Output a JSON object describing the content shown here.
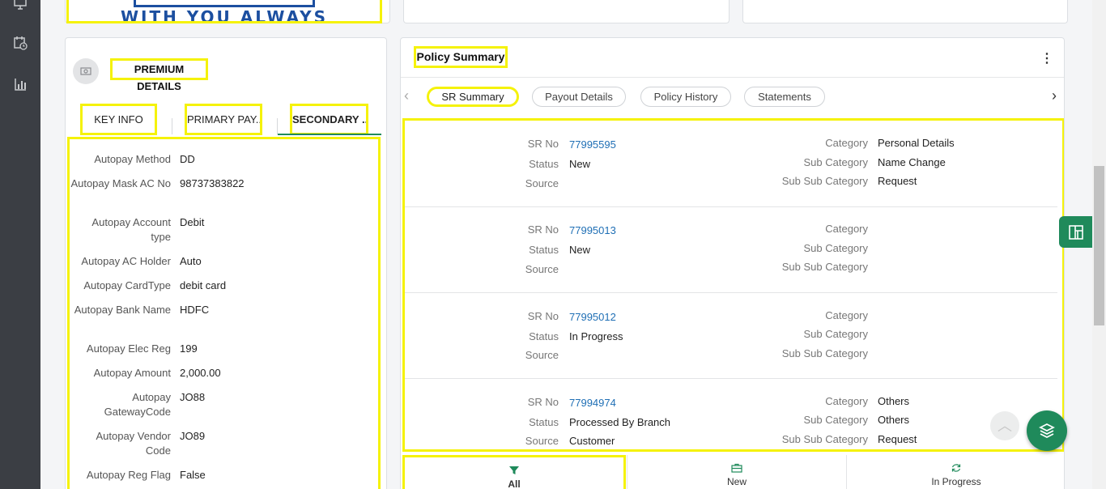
{
  "banner": {
    "text": "WITH YOU ALWAYS"
  },
  "premium": {
    "title": "PREMIUM DETAILS",
    "tabs": [
      {
        "label": "KEY INFO"
      },
      {
        "label": "PRIMARY PAY..."
      },
      {
        "label": "SECONDARY ..."
      }
    ],
    "active_tab": "SECONDARY ...",
    "fields": [
      {
        "label": "Autopay Method",
        "value": "DD"
      },
      {
        "label": "Autopay Mask AC No",
        "value": "98737383822"
      },
      {
        "label": "Autopay Account type",
        "value": "Debit"
      },
      {
        "label": "Autopay AC Holder",
        "value": "Auto"
      },
      {
        "label": "Autopay CardType",
        "value": "debit card"
      },
      {
        "label": "Autopay Bank Name",
        "value": "HDFC"
      },
      {
        "label": "Autopay Elec Reg",
        "value": "199"
      },
      {
        "label": "Autopay Amount",
        "value": "2,000.00"
      },
      {
        "label": "Autopay GatewayCode",
        "value": "JO88"
      },
      {
        "label": "Autopay Vendor Code",
        "value": "JO89"
      },
      {
        "label": "Autopay Reg Flag",
        "value": "False"
      }
    ]
  },
  "policy": {
    "title": "Policy Summary",
    "menu_icon": "kebab-icon",
    "tabs": [
      {
        "label": "SR Summary"
      },
      {
        "label": "Payout Details"
      },
      {
        "label": "Policy History"
      },
      {
        "label": "Statements"
      }
    ],
    "active_tab": "SR Summary",
    "labels": {
      "sr_no": "SR No",
      "status": "Status",
      "source": "Source",
      "category": "Category",
      "sub_category": "Sub Category",
      "sub_sub_category": "Sub Sub Category"
    },
    "records": [
      {
        "sr_no": "77995595",
        "status": "New",
        "source": "",
        "category": "Personal Details",
        "sub_category": "Name Change",
        "sub_sub_category": "Request"
      },
      {
        "sr_no": "77995013",
        "status": "New",
        "source": "",
        "category": "",
        "sub_category": "",
        "sub_sub_category": ""
      },
      {
        "sr_no": "77995012",
        "status": "In Progress",
        "source": "",
        "category": "",
        "sub_category": "",
        "sub_sub_category": ""
      },
      {
        "sr_no": "77994974",
        "status": "Processed By Branch",
        "source": "Customer",
        "category": "Others",
        "sub_category": "Others",
        "sub_sub_category": "Request"
      }
    ],
    "bottom_tabs": [
      {
        "label": "All",
        "icon": "filter-icon"
      },
      {
        "label": "New",
        "icon": "briefcase-icon"
      },
      {
        "label": "In Progress",
        "icon": "refresh-icon"
      }
    ],
    "active_bottom_tab": "All"
  },
  "colors": {
    "accent": "#1f8a5b",
    "link": "#1f6fb5",
    "highlight": "#f5f20a",
    "sidebar": "#3b3e44"
  }
}
